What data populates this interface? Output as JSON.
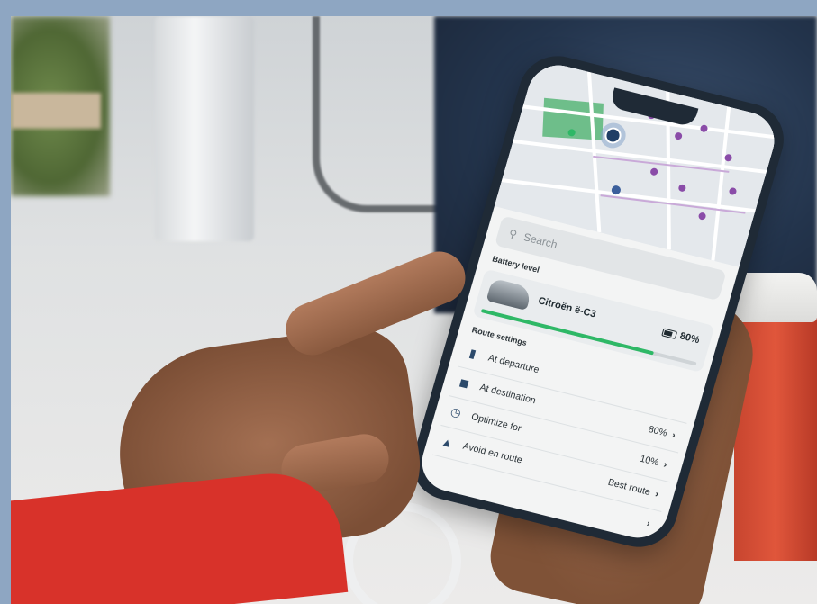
{
  "app": {
    "search": {
      "icon": "search-icon",
      "placeholder": "Search"
    },
    "battery_section": {
      "title": "Battery level"
    },
    "vehicle": {
      "name": "Citroën ë-C3",
      "battery_label": "80%",
      "battery_level": 0.8
    },
    "route_section": {
      "title": "Route settings"
    },
    "route_items": [
      {
        "icon": "battery-icon",
        "label": "At departure",
        "value": ""
      },
      {
        "icon": "car-icon",
        "label": "At destination",
        "value": "80%"
      },
      {
        "icon": "timer-icon",
        "label": "Optimize for",
        "value": "10%"
      },
      {
        "icon": "avoid-icon",
        "label": "Avoid en route",
        "value": "Best route"
      }
    ],
    "chevron": "›",
    "accent_green": "#2eb866"
  }
}
